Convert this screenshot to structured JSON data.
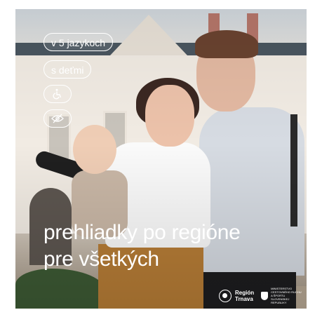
{
  "chips": {
    "languages": "v 5 jazykoch",
    "children": "s deťmi",
    "wheelchair_icon": "wheelchair-icon",
    "visually_impaired_icon": "eye-slash-icon"
  },
  "headline": {
    "line1": "prehliadky po regióne",
    "line2": "pre všetkých"
  },
  "logos": {
    "region_line1": "Región",
    "region_line2": "Trnava",
    "ministry": "MINISTERSTVO CESTOVNÉHO RUCHU A ŠPORTU SLOVENSKEJ REPUBLIKY"
  },
  "colors": {
    "text": "#ffffff"
  }
}
